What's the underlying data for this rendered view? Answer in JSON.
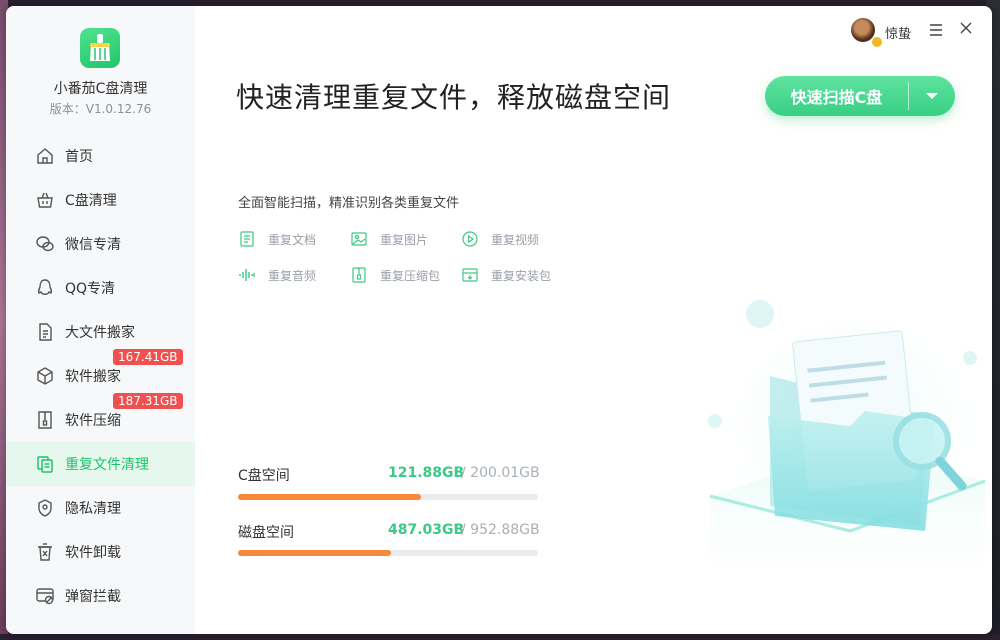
{
  "app": {
    "name": "小番茄C盘清理",
    "version": "版本：V1.0.12.76"
  },
  "user": {
    "name": "惊蛰"
  },
  "sidebar": {
    "items": [
      {
        "label": "首页",
        "icon": "home-icon"
      },
      {
        "label": "C盘清理",
        "icon": "basket-icon"
      },
      {
        "label": "微信专清",
        "icon": "wechat-icon"
      },
      {
        "label": "QQ专清",
        "icon": "qq-icon"
      },
      {
        "label": "大文件搬家",
        "icon": "file-move-icon"
      },
      {
        "label": "软件搬家",
        "icon": "box-icon",
        "badge": "167.41GB"
      },
      {
        "label": "软件压缩",
        "icon": "zip-icon",
        "badge": "187.31GB"
      },
      {
        "label": "重复文件清理",
        "icon": "duplicate-icon",
        "active": true
      },
      {
        "label": "隐私清理",
        "icon": "privacy-icon"
      },
      {
        "label": "软件卸载",
        "icon": "uninstall-icon"
      },
      {
        "label": "弹窗拦截",
        "icon": "popup-block-icon"
      }
    ]
  },
  "main": {
    "headline": "快速清理重复文件，释放磁盘空间",
    "scan_button": "快速扫描C盘",
    "subtitle": "全面智能扫描，精准识别各类重复文件",
    "features": [
      {
        "label": "重复文档",
        "icon": "document-icon"
      },
      {
        "label": "重复图片",
        "icon": "image-icon"
      },
      {
        "label": "重复视频",
        "icon": "video-icon"
      },
      {
        "label": "重复音频",
        "icon": "audio-icon"
      },
      {
        "label": "重复压缩包",
        "icon": "archive-icon"
      },
      {
        "label": "重复安装包",
        "icon": "installer-icon"
      }
    ],
    "disks": [
      {
        "label": "C盘空间",
        "used": "121.88GB",
        "total": "/ 200.01GB",
        "fraction": 0.61
      },
      {
        "label": "磁盘空间",
        "used": "487.03GB",
        "total": "/ 952.88GB",
        "fraction": 0.51
      }
    ]
  },
  "colors": {
    "accent": "#3cc985",
    "badge": "#f0504f",
    "bar": "#f7883a"
  }
}
